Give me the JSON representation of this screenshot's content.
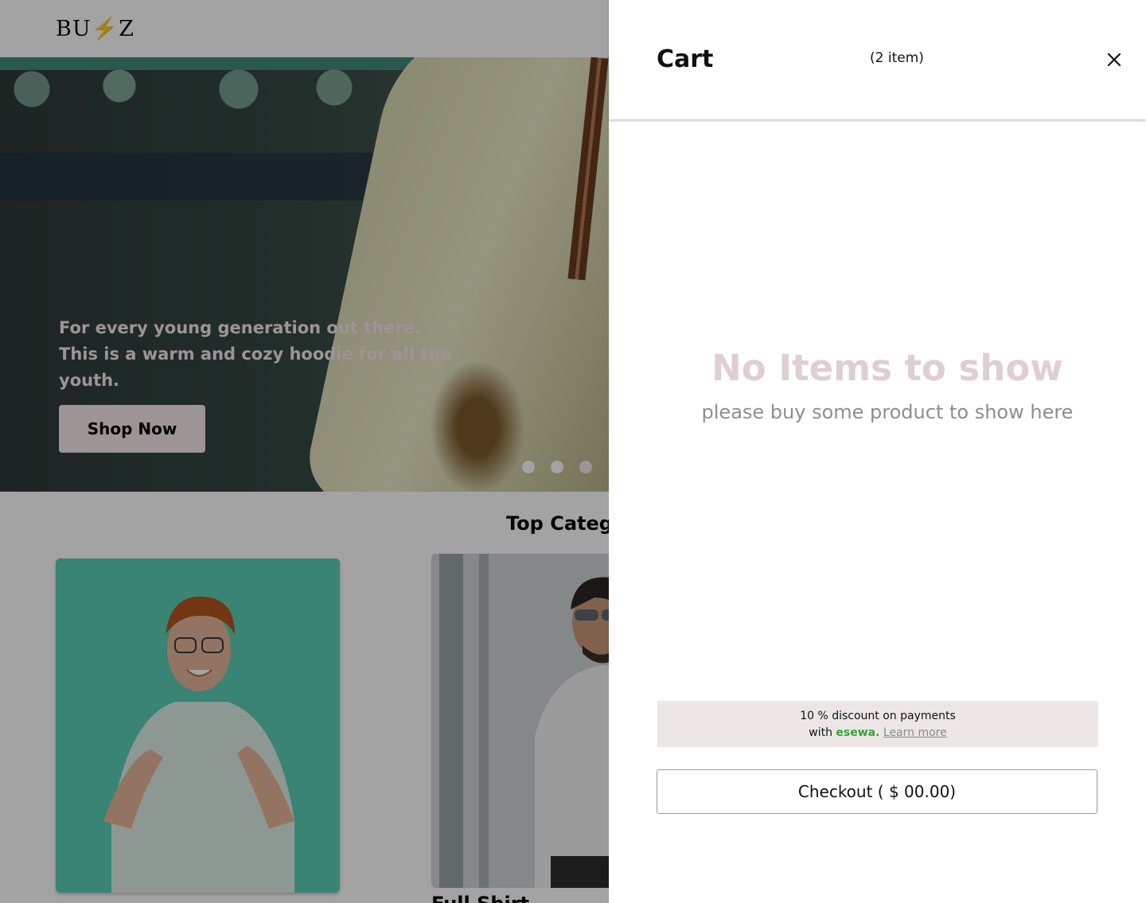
{
  "navbar": {
    "logo": "BU⚡Z"
  },
  "hero": {
    "tagline": "For every young generation out there. This is a warm and cozy hoodie for all the youth.",
    "cta_label": "Shop  Now",
    "slide_count": 3,
    "active_slide": 3
  },
  "categories": {
    "title": "Top Categories",
    "items": [
      {
        "label": ""
      },
      {
        "label": "Full Shirt"
      }
    ]
  },
  "cart": {
    "title": "Cart",
    "count_label": "(2 item)",
    "empty_title": "No Items  to show",
    "empty_subtitle": "please  buy some product to show here",
    "promo": {
      "line1": "10 % discount on payments",
      "line2_prefix": "with",
      "brand": "esewa.",
      "link": "Learn more"
    },
    "checkout_label": "Checkout ( $ 00.00)"
  },
  "colors": {
    "accent_pink": "#f5e8ea",
    "empty_title": "#dfcfd0",
    "esewa_green": "#3aa13a",
    "promo_bg": "#ede6e7"
  },
  "icons": {
    "close": "close-icon"
  }
}
